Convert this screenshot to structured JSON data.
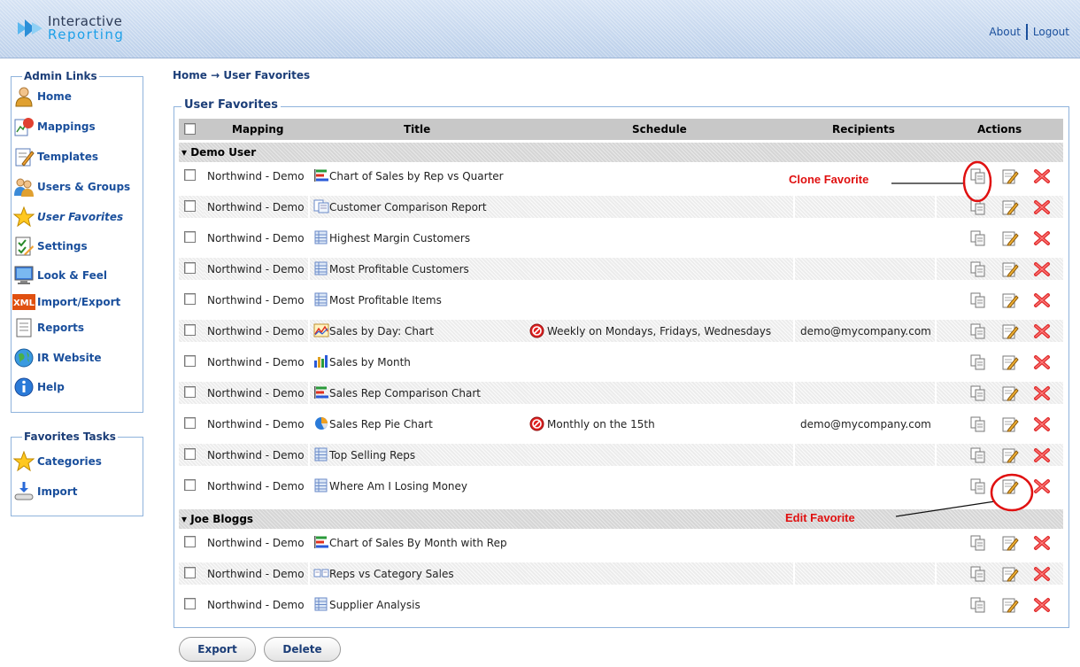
{
  "header": {
    "logo_line1": "Interactive",
    "logo_line2": "Reporting",
    "about": "About",
    "logout": "Logout"
  },
  "admin_links": {
    "title": "Admin Links",
    "items": [
      {
        "label": "Home",
        "icon": "user-icon"
      },
      {
        "label": "Mappings",
        "icon": "mappings-icon"
      },
      {
        "label": "Templates",
        "icon": "templates-icon"
      },
      {
        "label": "Users & Groups",
        "icon": "users-groups-icon"
      },
      {
        "label": "User Favorites",
        "icon": "star-icon"
      },
      {
        "label": "Settings",
        "icon": "settings-icon"
      },
      {
        "label": "Look & Feel",
        "icon": "monitor-icon"
      },
      {
        "label": "Import/Export",
        "icon": "xml-icon"
      },
      {
        "label": "Reports",
        "icon": "report-icon"
      },
      {
        "label": "IR Website",
        "icon": "globe-icon"
      },
      {
        "label": "Help",
        "icon": "help-icon"
      }
    ]
  },
  "favorites_tasks": {
    "title": "Favorites Tasks",
    "items": [
      {
        "label": "Categories",
        "icon": "star-icon"
      },
      {
        "label": "Import",
        "icon": "import-icon"
      }
    ]
  },
  "breadcrumb": "Home → User Favorites",
  "panel_title": "User Favorites",
  "columns": {
    "mapping": "Mapping",
    "title": "Title",
    "schedule": "Schedule",
    "recipients": "Recipients",
    "actions": "Actions"
  },
  "groups": [
    {
      "name": "Demo User",
      "rows": [
        {
          "mapping": "Northwind - Demo",
          "title": "Chart of Sales by Rep vs Quarter",
          "icon": "bar-chart-icon",
          "schedule": "",
          "recipients": ""
        },
        {
          "mapping": "Northwind - Demo",
          "title": "Customer Comparison Report",
          "icon": "comparison-icon",
          "schedule": "",
          "recipients": ""
        },
        {
          "mapping": "Northwind - Demo",
          "title": "Highest Margin Customers",
          "icon": "table-icon",
          "schedule": "",
          "recipients": ""
        },
        {
          "mapping": "Northwind - Demo",
          "title": "Most Profitable Customers",
          "icon": "table-icon",
          "schedule": "",
          "recipients": ""
        },
        {
          "mapping": "Northwind - Demo",
          "title": "Most Profitable Items",
          "icon": "table-icon",
          "schedule": "",
          "recipients": ""
        },
        {
          "mapping": "Northwind - Demo",
          "title": "Sales by Day: Chart",
          "icon": "line-chart-icon",
          "schedule": "Weekly on Mondays, Fridays, Wednesdays",
          "recipients": "demo@mycompany.com"
        },
        {
          "mapping": "Northwind - Demo",
          "title": "Sales by Month",
          "icon": "column-chart-icon",
          "schedule": "",
          "recipients": ""
        },
        {
          "mapping": "Northwind - Demo",
          "title": "Sales Rep Comparison Chart",
          "icon": "bar-chart-icon",
          "schedule": "",
          "recipients": ""
        },
        {
          "mapping": "Northwind - Demo",
          "title": "Sales Rep Pie Chart",
          "icon": "pie-chart-icon",
          "schedule": "Monthly on the 15th",
          "recipients": "demo@mycompany.com"
        },
        {
          "mapping": "Northwind - Demo",
          "title": "Top Selling Reps",
          "icon": "table-icon",
          "schedule": "",
          "recipients": ""
        },
        {
          "mapping": "Northwind - Demo",
          "title": "Where Am I Losing Money",
          "icon": "table-icon",
          "schedule": "",
          "recipients": ""
        }
      ]
    },
    {
      "name": "Joe Bloggs",
      "rows": [
        {
          "mapping": "Northwind - Demo",
          "title": "Chart of Sales By Month with Rep",
          "icon": "bar-chart-icon",
          "schedule": "",
          "recipients": ""
        },
        {
          "mapping": "Northwind - Demo",
          "title": "Reps vs Category Sales",
          "icon": "dual-report-icon",
          "schedule": "",
          "recipients": ""
        },
        {
          "mapping": "Northwind - Demo",
          "title": "Supplier Analysis",
          "icon": "table-icon",
          "schedule": "",
          "recipients": ""
        }
      ]
    }
  ],
  "annotations": {
    "clone": "Clone Favorite",
    "edit": "Edit Favorite"
  },
  "buttons": {
    "export": "Export",
    "delete": "Delete"
  },
  "colors": {
    "link": "#1a4f9c",
    "annotation": "#e01010"
  }
}
